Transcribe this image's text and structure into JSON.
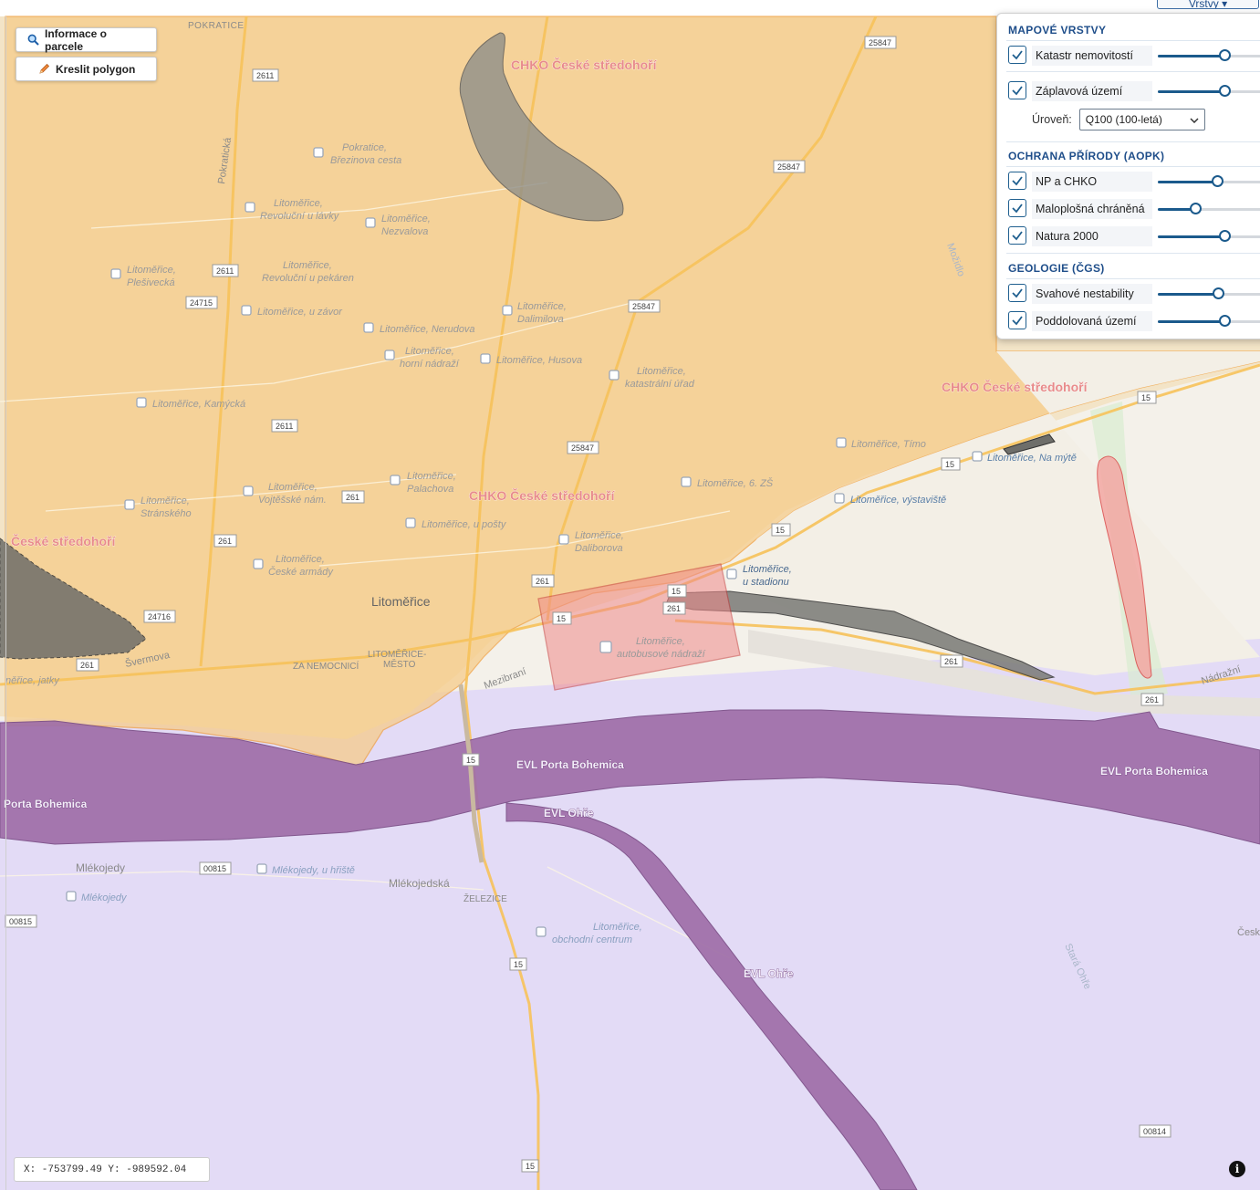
{
  "toolbar": {
    "parcel_info_label": "Informace o parcele",
    "draw_polygon_label": "Kreslit polygon"
  },
  "layers_toggle_label": "Vrstvy",
  "coords": "X: -753799.49 Y: -989592.04",
  "info_label": "i",
  "panel": {
    "sections": [
      {
        "title": "MAPOVÉ VRSTVY",
        "items": [
          {
            "label": "Katastr nemovitostí",
            "checked": true,
            "opacity": 0.6
          },
          {
            "label": "Záplavová území",
            "checked": true,
            "opacity": 0.6
          }
        ]
      },
      {
        "title": "OCHRANA PŘÍRODY (AOPK)",
        "items": [
          {
            "label": "NP a CHKO",
            "checked": true,
            "opacity": 0.53
          },
          {
            "label": "Maloplošná chráněná",
            "checked": true,
            "opacity": 0.34
          },
          {
            "label": "Natura 2000",
            "checked": true,
            "opacity": 0.6
          }
        ]
      },
      {
        "title": "GEOLOGIE (ČGS)",
        "items": [
          {
            "label": "Svahové nestability",
            "checked": true,
            "opacity": 0.54
          },
          {
            "label": "Poddolovaná území",
            "checked": true,
            "opacity": 0.6
          }
        ]
      }
    ],
    "flood_level": {
      "label": "Úroveň:",
      "value": "Q100 (100-letá)"
    }
  },
  "map": {
    "zone_labels": {
      "chko1": "CHKO České středohoří",
      "chko2": "CHKO České středohoří",
      "chko3": "CHKO České středohoří",
      "chko4": "České středohoří",
      "evl1": "EVL Porta Bohemica",
      "evl2": "EVL Porta Bohemica",
      "evl3": "Porta Bohemica",
      "ohre1": "EVL Ohře",
      "ohre2": "EVL Ohře"
    },
    "places": {
      "pokratice": "POKRATICE",
      "litomerice": "Litoměřice",
      "litomerice_mesto": "LITOMĚŘICE-",
      "litomerice_mesto2": "MĚSTO",
      "za_nemocnici": "ZA NEMOCNICÍ",
      "zelezice": "ŽELEZICE",
      "mlekojedy": "Mlékojedy",
      "mlekojedska": "Mlékojedská",
      "svermova": "Švermova",
      "mezibrani": "Mezibraní",
      "nadrazni": "Nádražní",
      "pokraticka": "Pokratická",
      "mozidlo": "Možidlo",
      "stara_ohre": "Stará Ohře",
      "cesk": "Česk"
    },
    "stops": [
      "Pokratice,",
      "Březinova cesta",
      "Litoměřice,",
      "Revoluční u lávky",
      "Litoměřice,",
      "Nezvalova",
      "Litoměřice,",
      "Plešivecká",
      "Litoměřice,",
      "Revoluční u pekáren",
      "Litoměřice, u závor",
      "Litoměřice,",
      "Dalimilova",
      "Litoměřice, Nerudova",
      "Litoměřice,",
      "horní nádraží",
      "Litoměřice, Husova",
      "Litoměřice,",
      "katastrální úřad",
      "Litoměřice, Kamýcká",
      "Litoměřice, Tímo",
      "Litoměřice, Na mýtě",
      "Litoměřice,",
      "Palachova",
      "Litoměřice, 6. ZŠ",
      "Litoměřice,",
      "Vojtěšské nám.",
      "Litoměřice,",
      "Stránského",
      "Litoměřice, výstaviště",
      "Litoměřice, u pošty",
      "Litoměřice,",
      "Daliborova",
      "Litoměřice,",
      "České armády",
      "Litoměřice,",
      "u stadionu",
      "Litoměřice,",
      "autobusové nádraží",
      "Mlékojedy, u hřiště",
      "Mlékojedy",
      "Litoměřice,",
      "obchodní centrum",
      "něřice, jatky"
    ],
    "road_numbers": [
      "2611",
      "25847",
      "25847",
      "2611",
      "24715",
      "25847",
      "2611",
      "25847",
      "261",
      "261",
      "15",
      "15",
      "15",
      "261",
      "15",
      "261",
      "24716",
      "261",
      "261",
      "15",
      "261",
      "00815",
      "00815",
      "15",
      "15",
      "15",
      "00814"
    ]
  },
  "colors": {
    "chko_fill": "#f5c57a",
    "natura_fill": "#d9ccf0",
    "evl_fill": "#9e6ba6",
    "slope_fill": "#8a8a86",
    "flood_red": "#e85a5a",
    "accent": "#1f4e8a"
  }
}
